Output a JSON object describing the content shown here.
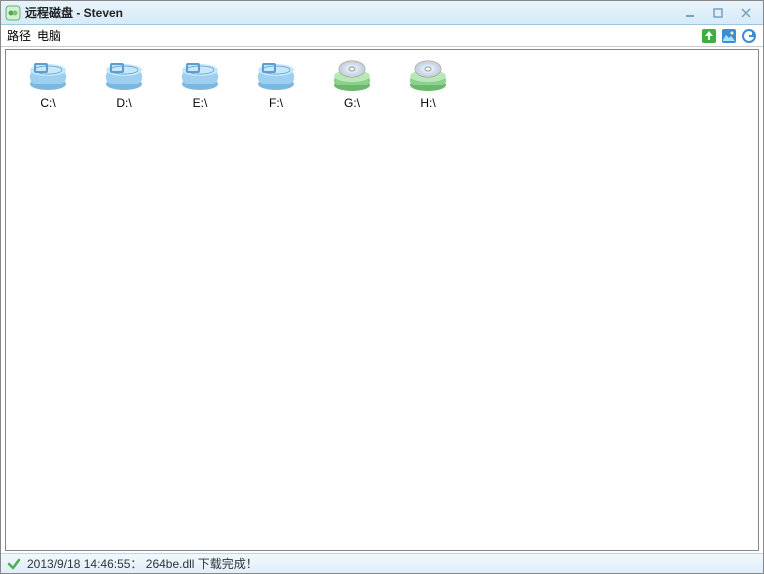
{
  "window": {
    "title": "远程磁盘  - Steven"
  },
  "toolbar": {
    "path_label": "路径",
    "path_value": "电脑"
  },
  "drives": [
    {
      "label": "C:\\",
      "type": "hdd"
    },
    {
      "label": "D:\\",
      "type": "hdd"
    },
    {
      "label": "E:\\",
      "type": "hdd"
    },
    {
      "label": "F:\\",
      "type": "hdd"
    },
    {
      "label": "G:\\",
      "type": "cd"
    },
    {
      "label": "H:\\",
      "type": "cd"
    }
  ],
  "status": {
    "text": "2013/9/18 14:46:55：  264be.dll 下载完成！"
  }
}
